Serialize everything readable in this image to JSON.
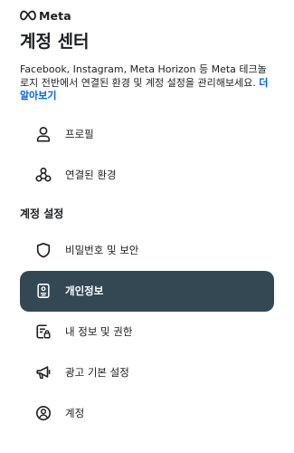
{
  "brand": {
    "name": "Meta"
  },
  "page": {
    "title": "계정 센터",
    "description": "Facebook, Instagram, Meta Horizon 등 Meta 테크놀로지 전반에서 연결된 환경 및 계정 설정을 관리해보세요.",
    "learn_more": "더 알아보기"
  },
  "nav": {
    "top_items": [
      {
        "label": "프로필",
        "icon": "person-icon"
      },
      {
        "label": "연결된 환경",
        "icon": "connected-experiences-icon"
      }
    ],
    "section_title": "계정 설정",
    "settings_items": [
      {
        "label": "비밀번호 및 보안",
        "icon": "shield-icon"
      },
      {
        "label": "개인정보",
        "icon": "id-card-icon",
        "active": true
      },
      {
        "label": "내 정보 및 권한",
        "icon": "info-permissions-icon"
      },
      {
        "label": "광고 기본 설정",
        "icon": "megaphone-icon"
      },
      {
        "label": "계정",
        "icon": "account-circle-icon"
      }
    ]
  },
  "colors": {
    "active_bg": "#344854",
    "link": "#0064e0",
    "text": "#1c1e21"
  }
}
